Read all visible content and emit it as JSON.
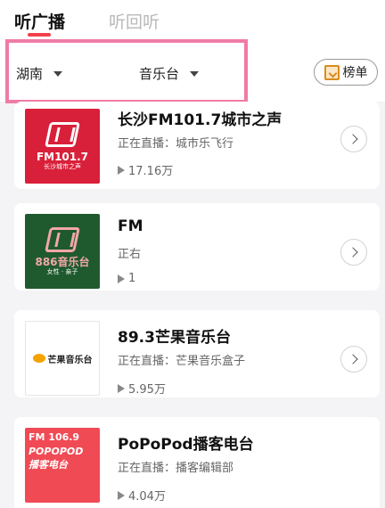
{
  "tabs": {
    "active": "听广播",
    "inactive": "听回听",
    "accent": "#f2414b"
  },
  "filters": {
    "region": "湖南",
    "category": "音乐台",
    "rank_label": "榜单",
    "highlight_color": "#f07ba6"
  },
  "stations": [
    {
      "title": "长沙FM101.7城市之声",
      "live": "正在直播：城市乐飞行",
      "plays": "17.16万",
      "logo_line1": "FM101.7",
      "logo_line2": "长沙城市之声",
      "logo_bg": "#d9203a"
    },
    {
      "title": "FM",
      "live": "正右",
      "plays": "1",
      "logo_line1": "886音乐台",
      "logo_line2": "女性 · 亲子",
      "logo_bg": "#1f5a2e"
    },
    {
      "title": "89.3芒果音乐台",
      "live": "正在直播：芒果音乐盒子",
      "plays": "5.95万",
      "logo_line1": "芒果音乐台",
      "logo_line2": "",
      "logo_bg": "#ffffff"
    },
    {
      "title": "PoPoPod播客电台",
      "live": "正在直播：播客编辑部",
      "plays": "4.04万",
      "logo_line1": "FM 106.9",
      "logo_line2": "POPOPOD 播客电台",
      "logo_bg": "#f04a55"
    }
  ]
}
